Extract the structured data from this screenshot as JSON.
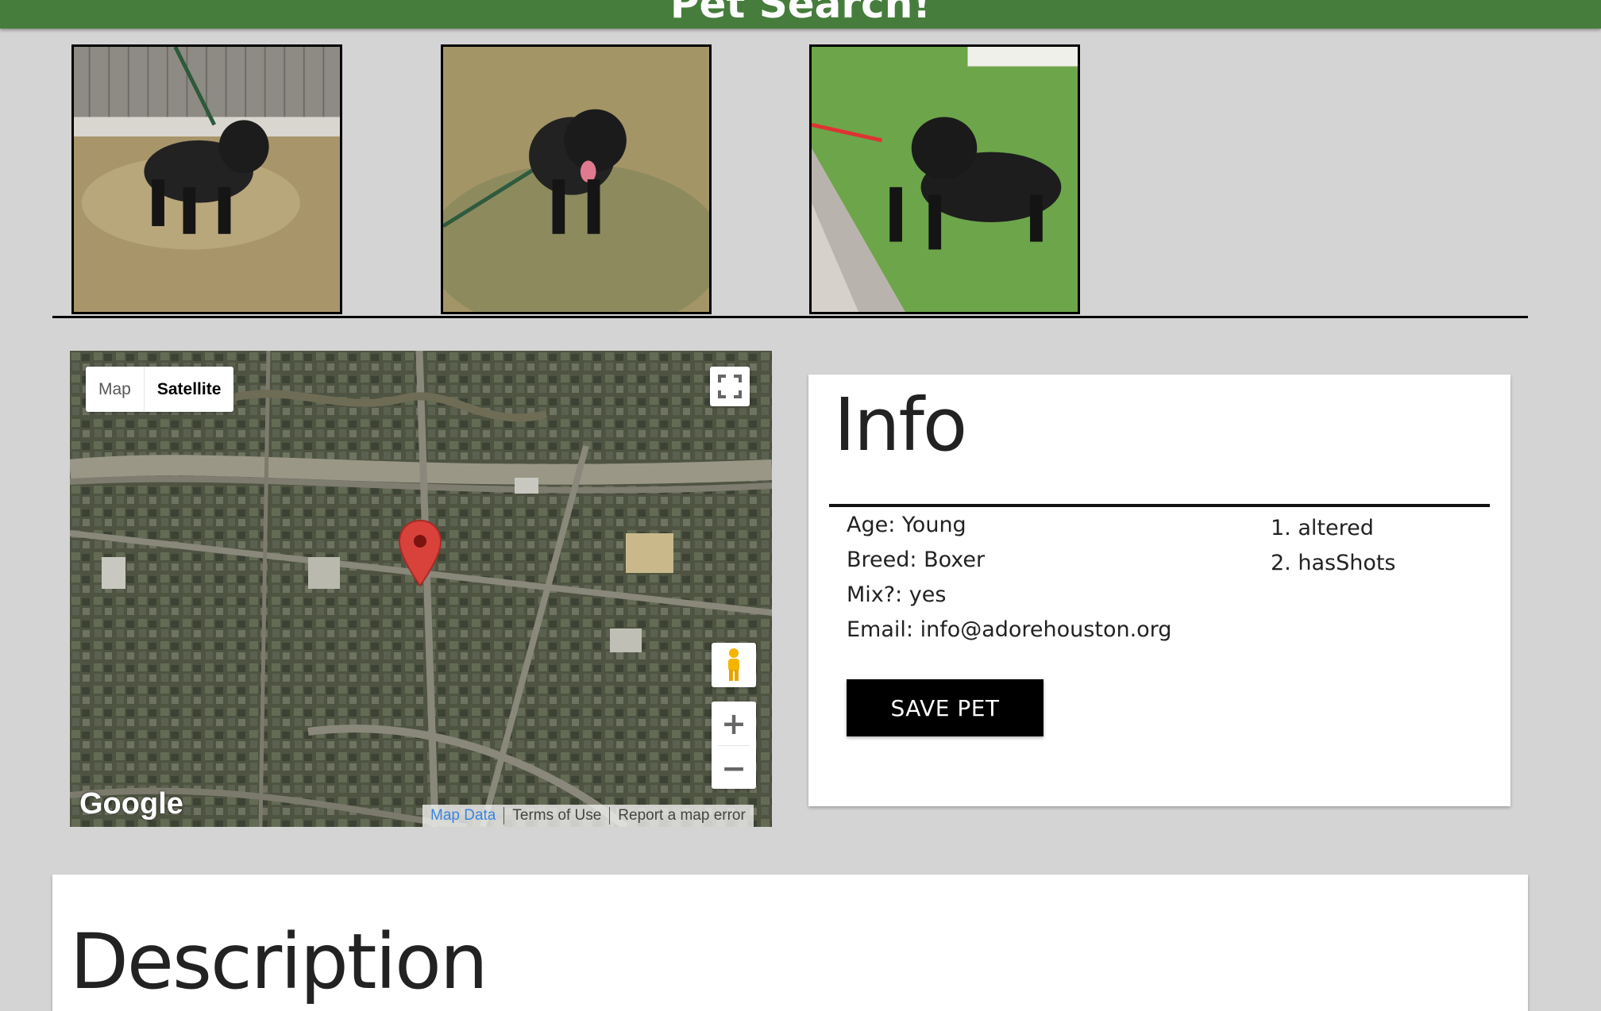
{
  "header": {
    "title": "Pet Search!"
  },
  "photos": [
    {
      "alt": "black dog photo 1"
    },
    {
      "alt": "black dog photo 2"
    },
    {
      "alt": "black dog photo 3"
    }
  ],
  "map": {
    "type_map": "Map",
    "type_satellite": "Satellite",
    "zoom_in": "+",
    "zoom_out": "−",
    "logo": "Google",
    "footer": {
      "map_data": "Map Data",
      "terms": "Terms of Use",
      "report": "Report a map error"
    }
  },
  "info": {
    "title": "Info",
    "age": "Age: Young",
    "breed": "Breed: Boxer",
    "mix": "Mix?: yes",
    "email": "Email: info@adorehouston.org",
    "attributes": [
      "1. altered",
      "2. hasShots"
    ],
    "save_label": "SAVE PET"
  },
  "description": {
    "title": "Description"
  },
  "colors": {
    "header": "#467d3c",
    "page_bg": "#d4d4d4",
    "button": "#000000",
    "pin": "#d8423a"
  }
}
